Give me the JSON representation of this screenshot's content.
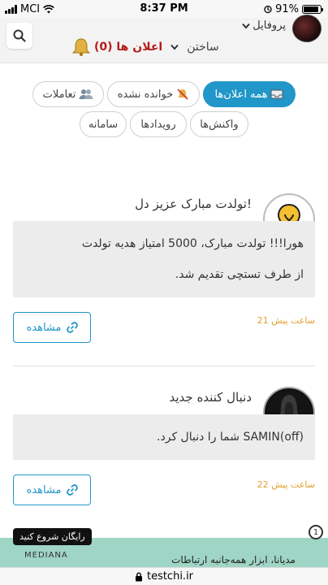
{
  "status_bar": {
    "carrier": "MCI",
    "time": "8:37 PM",
    "battery": "91%",
    "battery_level": 0.91
  },
  "header": {
    "profile_label": "پروفایل",
    "build_label": "ساختن",
    "notifications_label": "اعلان ها (0)"
  },
  "tabs": [
    {
      "label": "همه اعلان‌ها",
      "icon": "inbox-icon",
      "active": true
    },
    {
      "label": "خوانده نشده",
      "icon": "bell-off-icon",
      "active": false
    },
    {
      "label": "تعاملات",
      "icon": "users-icon",
      "active": false
    },
    {
      "label": "واکنش‌ها",
      "active": false
    },
    {
      "label": "رویدادها",
      "active": false
    },
    {
      "label": "سامانه",
      "active": false
    }
  ],
  "notifications": [
    {
      "title": "تولدت مبارک عزیز دل!",
      "body_line1": "هورا!!! تولدت مبارک، 5000 امتیاز هدیه تولدت",
      "body_line2": "از طرف تستچی تقدیم شد.",
      "view_label": "مشاهده",
      "time": "21 ساعت پیش",
      "icon": "lightbulb-icon"
    },
    {
      "title": "دنبال کننده جدید",
      "body_line1": "SAMIN(off) شما را دنبال کرد.",
      "view_label": "مشاهده",
      "time": "22 ساعت پیش",
      "icon": "user-avatar-icon"
    }
  ],
  "ad": {
    "tag": "رایگان شروع کنید",
    "logo": "MEDIANA",
    "text": "مدیانا، ابزار همه‌جانبه ارتباطات",
    "badge": "1"
  },
  "url_bar": {
    "domain": "testchi.ir"
  },
  "colors": {
    "accent": "#2196c8",
    "notification_count": "#b71c1c",
    "time": "#e0a030",
    "ad_bg": "#9fd5c5"
  }
}
